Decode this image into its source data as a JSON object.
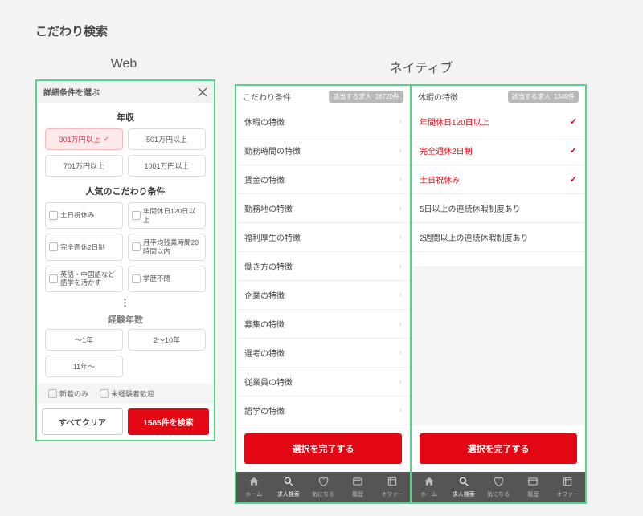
{
  "mainTitle": "こだわり検索",
  "webLabel": "Web",
  "nativeLabel": "ネイティブ",
  "web": {
    "header": "詳細条件を選ぶ",
    "salaryTitle": "年収",
    "salary": [
      "301万円以上",
      "501万円以上",
      "701万円以上",
      "1001万円以上"
    ],
    "selectedSalaryIndex": 0,
    "popTitle": "人気のこだわり条件",
    "popular": [
      "土日祝休み",
      "年間休日120日以上",
      "完全週休2日制",
      "月平均残業時間20時間以内",
      "英語・中国語など語学を活かす",
      "学歴不問"
    ],
    "dots": "⋮",
    "expTitle": "経験年数",
    "experience": [
      "〜1年",
      "2〜10年",
      "11年〜"
    ],
    "bottomChecks": [
      "新着のみ",
      "未経験者歓迎"
    ],
    "clear": "すべてクリア",
    "searchBtn": "1585件を検索"
  },
  "native1": {
    "title": "こだわり条件",
    "countLabel": "該当する求人",
    "count": "16720件",
    "rows": [
      "休暇の特徴",
      "勤務時間の特徴",
      "賃金の特徴",
      "勤務地の特徴",
      "福利厚生の特徴",
      "働き方の特徴",
      "企業の特徴",
      "募集の特徴",
      "選考の特徴",
      "従業員の特徴",
      "語学の特徴"
    ],
    "complete": "選択を完了する",
    "tabs": [
      "ホーム",
      "求人検索",
      "気になる",
      "履歴",
      "オファー"
    ],
    "activeTab": 1
  },
  "native2": {
    "title": "休暇の特徴",
    "countLabel": "該当する求人",
    "count": "1349件",
    "rows": [
      {
        "label": "年間休日120日以上",
        "sel": true
      },
      {
        "label": "完全週休2日制",
        "sel": true
      },
      {
        "label": "土日祝休み",
        "sel": true
      },
      {
        "label": "5日以上の連続休暇制度あり",
        "sel": false
      },
      {
        "label": "2週間以上の連続休暇制度あり",
        "sel": false
      }
    ],
    "complete": "選択を完了する",
    "tabs": [
      "ホーム",
      "求人検索",
      "気になる",
      "履歴",
      "オファー"
    ],
    "activeTab": 1
  }
}
